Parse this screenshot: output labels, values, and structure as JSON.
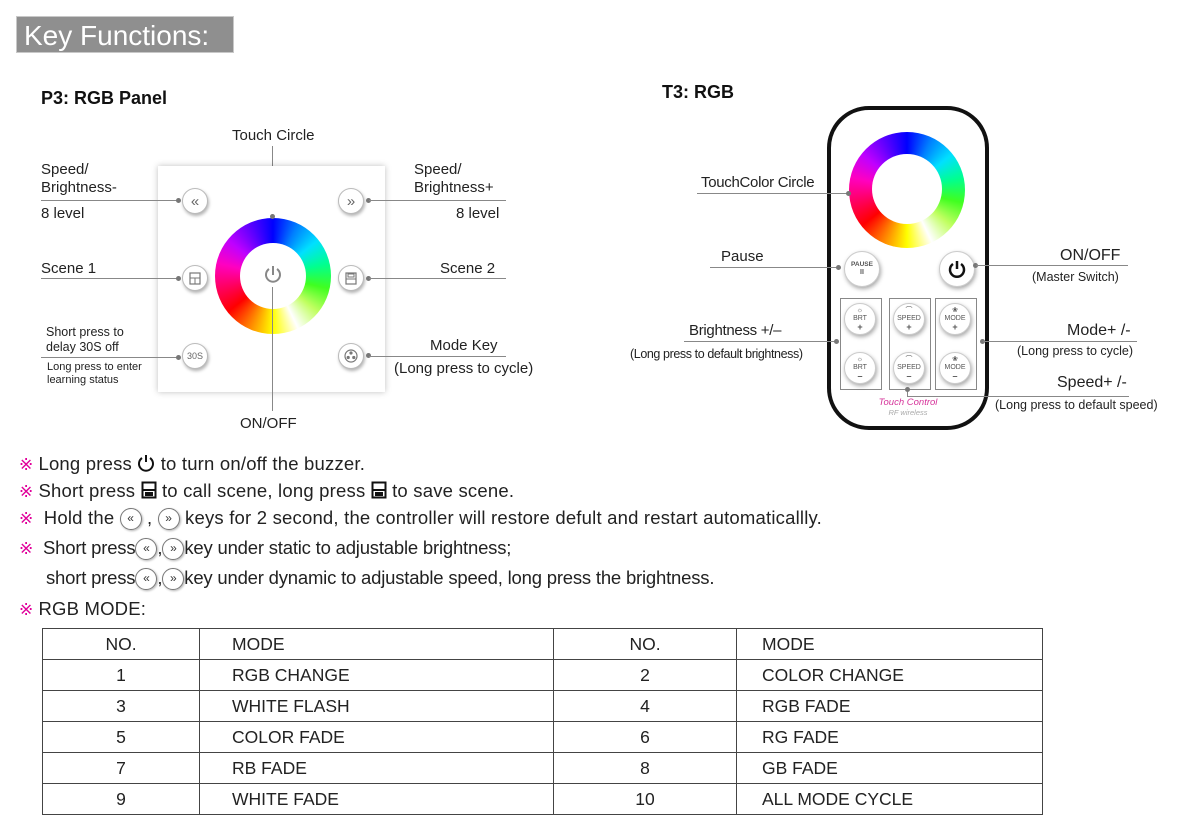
{
  "header": {
    "title": "Key Functions:"
  },
  "panel_section": {
    "title": "P3: RGB Panel",
    "labels": {
      "touch_circle": "Touch Circle",
      "speed_minus_line1": "Speed/",
      "speed_minus_line2": "Brightness-",
      "speed_minus_level": "8 level",
      "speed_plus_line1": "Speed/",
      "speed_plus_line2": "Brightness+",
      "speed_plus_level": "8 level",
      "scene1": "Scene 1",
      "scene2": "Scene 2",
      "delay_line1": "Short press to",
      "delay_line2": "delay 30S off",
      "learn_line1": "Long press to enter",
      "learn_line2": "learning status",
      "mode_key": "Mode Key",
      "mode_key_note": "(Long press to cycle)",
      "onoff": "ON/OFF"
    },
    "buttons": {
      "speed_minus": "«",
      "speed_plus": "»",
      "timer": "30S"
    }
  },
  "remote_section": {
    "title": "T3: RGB",
    "labels": {
      "touch_color_circle": "TouchColor Circle",
      "pause": "Pause",
      "onoff": "ON/OFF",
      "master_switch": "(Master Switch)",
      "brightness": "Brightness +/–",
      "brightness_note": "(Long press to default brightness)",
      "mode": "Mode+ /-",
      "mode_note": "(Long press to cycle)",
      "speed": "Speed+ /-",
      "speed_note": "(Long press to default speed)"
    },
    "buttons": {
      "pause_text": "PAUSE",
      "pause_symbol": "II",
      "brt": "BRT",
      "speed": "SPEED",
      "mode": "MODE",
      "plus": "+",
      "minus": "–"
    },
    "brand": "Touch Control",
    "brand_sub": "RF wireless",
    "brand_color": "#d6339a"
  },
  "notes": {
    "mark": "※",
    "n1_a": "Long press",
    "n1_b": "to turn on/off the buzzer.",
    "n2_a": "Short press",
    "n2_b": "to call scene, long press",
    "n2_c": "to save scene.",
    "n3_a": "Hold the",
    "n3_sep": ",",
    "n3_b": "keys for 2 second, the controller will restore defult and restart automaticallly.",
    "n4_a": "Short press",
    "n4_sep": ",",
    "n4_b": "key under static to adjustable brightness;",
    "n5_a": "short press",
    "n5_sep": ",",
    "n5_b": "key under dynamic to  adjustable speed, long press the brightness.",
    "n6": "RGB MODE:",
    "key_left": "«",
    "key_right": "»"
  },
  "mode_table": {
    "headers": [
      "NO.",
      "MODE",
      "NO.",
      "MODE"
    ],
    "rows": [
      [
        "1",
        "RGB CHANGE",
        "2",
        "COLOR CHANGE"
      ],
      [
        "3",
        "WHITE FLASH",
        "4",
        "RGB FADE"
      ],
      [
        "5",
        "COLOR FADE",
        "6",
        "RG FADE"
      ],
      [
        "7",
        "RB FADE",
        "8",
        "GB FADE"
      ],
      [
        "9",
        "WHITE FADE",
        "10",
        "ALL MODE CYCLE"
      ]
    ]
  }
}
